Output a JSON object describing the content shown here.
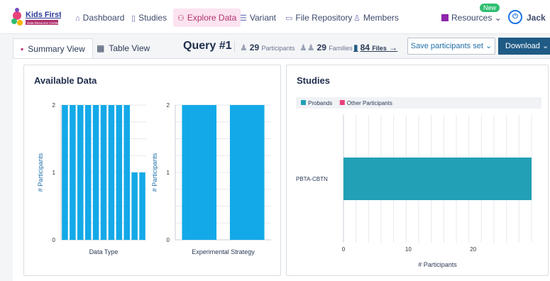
{
  "brand": {
    "name": "Kids First",
    "subtitle": "Data Resource Center"
  },
  "nav": {
    "items": [
      {
        "label": "Dashboard",
        "icon": "home-icon"
      },
      {
        "label": "Studies",
        "icon": "book-icon"
      },
      {
        "label": "Explore Data",
        "icon": "people-icon",
        "active": true
      },
      {
        "label": "Variant",
        "icon": "table-icon"
      },
      {
        "label": "File Repository",
        "icon": "folder-icon"
      },
      {
        "label": "Members",
        "icon": "user-icon"
      }
    ],
    "resources_label": "Resources",
    "new_badge": "New",
    "user_label": "Jack"
  },
  "toolbar": {
    "summary_tab": "Summary View",
    "table_tab": "Table View",
    "query_title": "Query #1",
    "participants_count": "29",
    "participants_label": "Participants",
    "families_count": "29",
    "families_label": "Families",
    "files_count": "84",
    "files_label": "Files",
    "save_label": "Save participants set",
    "download_label": "Download"
  },
  "available_data": {
    "title": "Available Data"
  },
  "studies": {
    "title": "Studies"
  },
  "chart_data": [
    {
      "type": "bar",
      "title": "",
      "xlabel": "Data Type",
      "ylabel": "# Participants",
      "ylim": [
        0,
        2
      ],
      "yticks": [
        0,
        1,
        2
      ],
      "categories": [
        "",
        "",
        "",
        "",
        "",
        "",
        "",
        "",
        "",
        "",
        ""
      ],
      "values": [
        2,
        2,
        2,
        2,
        2,
        2,
        2,
        2,
        2,
        1,
        1
      ],
      "color": "#13a9e8"
    },
    {
      "type": "bar",
      "title": "",
      "xlabel": "Experimental Strategy",
      "ylabel": "# Participants",
      "ylim": [
        0,
        2
      ],
      "yticks": [
        0,
        1,
        2
      ],
      "categories": [
        "",
        ""
      ],
      "values": [
        2,
        2
      ],
      "color": "#13a9e8"
    },
    {
      "type": "bar",
      "orientation": "horizontal",
      "title": "",
      "xlabel": "# Participants",
      "ylabel": "",
      "xlim": [
        0,
        29
      ],
      "xticks": [
        0,
        10,
        20
      ],
      "categories": [
        "PBTA-CBTN"
      ],
      "series": [
        {
          "name": "Probands",
          "values": [
            29
          ],
          "color": "#22a0b6"
        },
        {
          "name": "Other Participants",
          "values": [
            0
          ],
          "color": "#e8437a"
        }
      ],
      "legend": "top-left"
    }
  ]
}
